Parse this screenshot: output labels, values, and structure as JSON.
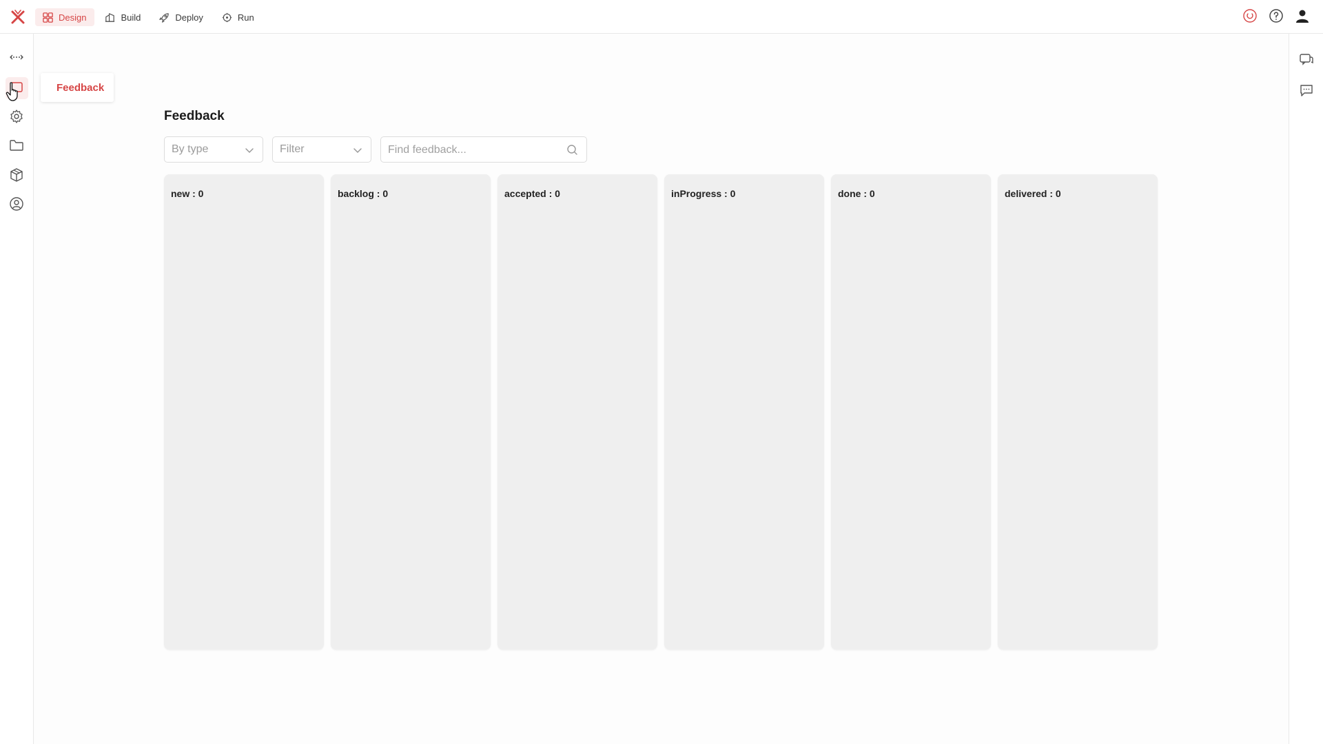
{
  "header": {
    "tabs": [
      {
        "label": "Design",
        "icon": "layout-grid-icon",
        "active": true
      },
      {
        "label": "Build",
        "icon": "build-icon",
        "active": false
      },
      {
        "label": "Deploy",
        "icon": "rocket-icon",
        "active": false
      },
      {
        "label": "Run",
        "icon": "run-icon",
        "active": false
      }
    ],
    "right_icons": [
      "power-icon",
      "help-icon",
      "user-icon"
    ]
  },
  "sidebar": {
    "items": [
      "expand-icon",
      "feedback-icon",
      "settings-icon",
      "folder-icon",
      "package-icon",
      "user-circle-icon"
    ],
    "active_tooltip": "Feedback"
  },
  "rightbar": {
    "items": [
      "messages-icon",
      "chat-icon"
    ]
  },
  "main": {
    "title": "Feedback",
    "type_select": {
      "placeholder": "By type"
    },
    "filter_select": {
      "placeholder": "Filter"
    },
    "search": {
      "placeholder": "Find feedback..."
    },
    "columns": [
      {
        "label": "new : 0"
      },
      {
        "label": "backlog : 0"
      },
      {
        "label": "accepted : 0"
      },
      {
        "label": "inProgress : 0"
      },
      {
        "label": "done : 0"
      },
      {
        "label": "delivered : 0"
      }
    ]
  },
  "colors": {
    "accent": "#d64545",
    "accent_bg": "#fbecec",
    "column_bg": "#efefef"
  }
}
